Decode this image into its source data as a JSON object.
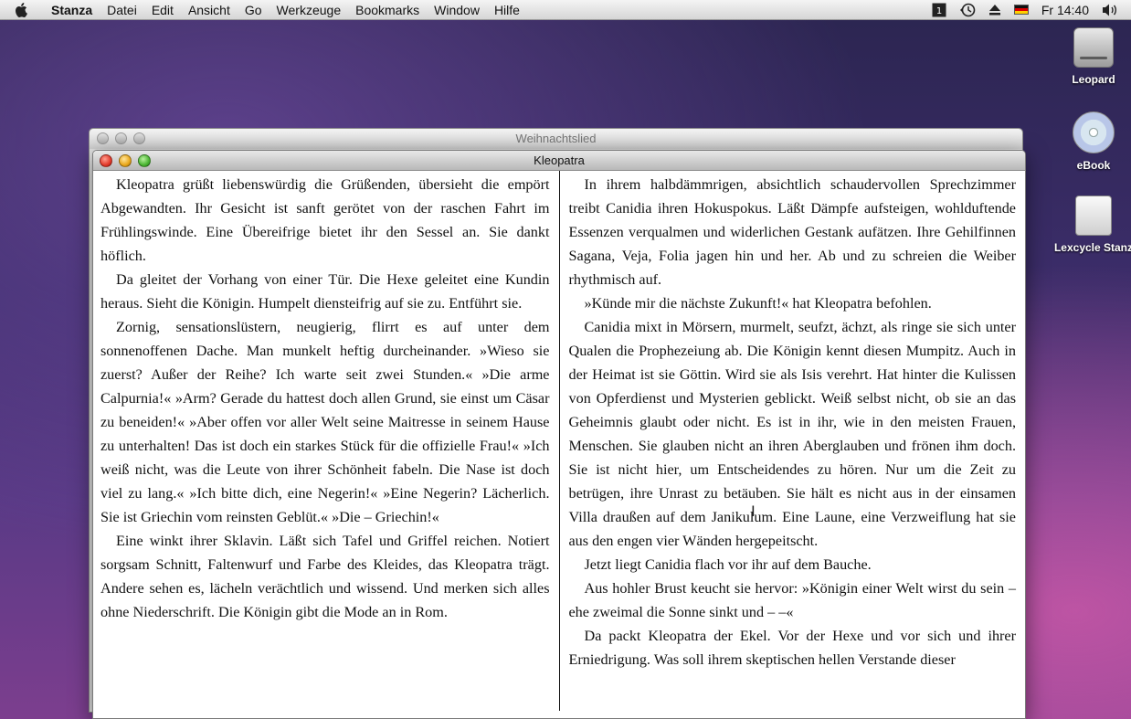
{
  "menubar": {
    "app_name": "Stanza",
    "items": [
      "Datei",
      "Edit",
      "Ansicht",
      "Go",
      "Werkzeuge",
      "Bookmarks",
      "Window",
      "Hilfe"
    ],
    "clock": "Fr 14:40"
  },
  "desktop": {
    "icons": [
      "Leopard",
      "eBook",
      "Lexcycle Stanz"
    ]
  },
  "background_window": {
    "title": "Weihnachtslied"
  },
  "window": {
    "title": "Kleopatra",
    "left_page": [
      "Kleopatra grüßt liebenswürdig die Grüßenden, übersieht die empört Abgewandten. Ihr Gesicht ist sanft gerötet von der raschen Fahrt im Frühlingswinde. Eine Übereifrige bietet ihr den Sessel an. Sie dankt höflich.",
      "Da gleitet der Vorhang von einer Tür. Die Hexe geleitet eine Kundin heraus. Sieht die Königin. Humpelt diensteifrig auf sie zu. Entführt sie.",
      "Zornig, sensationslüstern, neugierig, flirrt es auf unter dem sonnenoffenen Dache. Man munkelt heftig durcheinander. »Wieso sie zuerst? Außer der Reihe? Ich warte seit zwei Stunden.« »Die arme Calpurnia!« »Arm? Gerade du hattest doch allen Grund, sie einst um Cäsar zu beneiden!« »Aber offen vor aller Welt seine Maitresse in seinem Hause zu unterhalten! Das ist doch ein starkes Stück für die offizielle Frau!« »Ich weiß nicht, was die Leute von ihrer Schönheit fabeln. Die Nase ist doch viel zu lang.« »Ich bitte dich, eine Negerin!« »Eine Negerin? Lächerlich. Sie ist Griechin vom reinsten Geblüt.« »Die – Griechin!«",
      "Eine winkt ihrer Sklavin. Läßt sich Tafel und Griffel reichen. Notiert sorgsam Schnitt, Faltenwurf und Farbe des Kleides, das Kleopatra trägt. Andere sehen es, lächeln verächtlich und wissend. Und merken sich alles ohne Niederschrift. Die Königin gibt die Mode an in Rom."
    ],
    "right_page": [
      "In ihrem halbdämmrigen, absichtlich schaudervollen Sprechzimmer treibt Canidia ihren Hokuspokus. Läßt Dämpfe aufsteigen, wohlduftende Essenzen verqualmen und widerlichen Gestank aufätzen. Ihre Gehilfinnen Sagana, Veja, Folia jagen hin und her. Ab und zu schreien die Weiber rhythmisch auf.",
      "»Künde mir die nächste Zukunft!« hat Kleopatra befohlen.",
      "Canidia mixt in Mörsern, murmelt, seufzt, ächzt, als ringe sie sich unter Qualen die Prophezeiung ab. Die Königin kennt diesen Mumpitz. Auch in der Heimat ist sie Göttin. Wird sie als Isis verehrt. Hat hinter die Kulissen von Opferdienst und Mysterien geblickt. Weiß selbst nicht, ob sie an das Geheimnis glaubt oder nicht. Es ist in ihr, wie in den meisten Frauen, Menschen. Sie glauben nicht an ihren Aberglauben und frönen ihm doch. Sie ist nicht hier, um Entscheidendes zu hören. Nur um die Zeit zu betrügen, ihre Unrast zu betäuben. Sie hält es nicht aus in der einsamen Villa draußen auf dem Janikulum. Eine Laune, eine Verzweiflung hat sie aus den engen vier Wänden hergepeitscht.",
      "Jetzt liegt Canidia flach vor ihr auf dem Bauche.",
      "Aus hohler Brust keucht sie hervor: »Königin einer Welt wirst du sein – ehe zweimal die Sonne sinkt und – –«",
      "Da packt Kleopatra der Ekel. Vor der Hexe und vor sich und ihrer Erniedrigung. Was soll ihrem skeptischen hellen Verstande dieser"
    ]
  }
}
